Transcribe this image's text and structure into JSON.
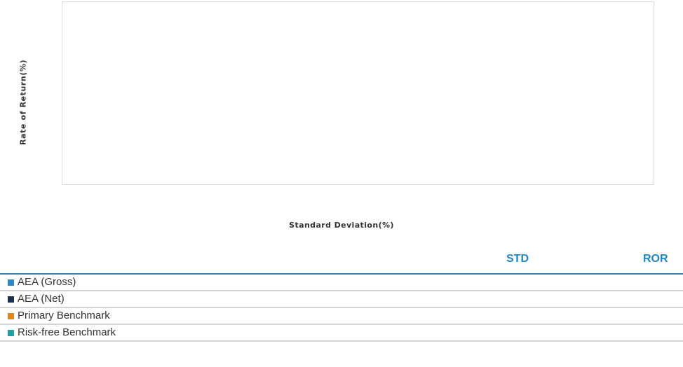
{
  "chart_data": {
    "type": "scatter",
    "title": "",
    "xlabel": "Standard Deviation(%)",
    "ylabel": "Rate of Return(%)",
    "series": [
      {
        "name": "AEA (Gross)",
        "color": "#2d86c6",
        "std": "",
        "ror": ""
      },
      {
        "name": "AEA (Net)",
        "color": "#1b2f52",
        "std": "",
        "ror": ""
      },
      {
        "name": "Primary Benchmark",
        "color": "#e0861f",
        "std": "",
        "ror": ""
      },
      {
        "name": "Risk-free Benchmark",
        "color": "#239ea0",
        "std": "",
        "ror": ""
      }
    ]
  },
  "table": {
    "columns": [
      "STD",
      "ROR"
    ]
  }
}
